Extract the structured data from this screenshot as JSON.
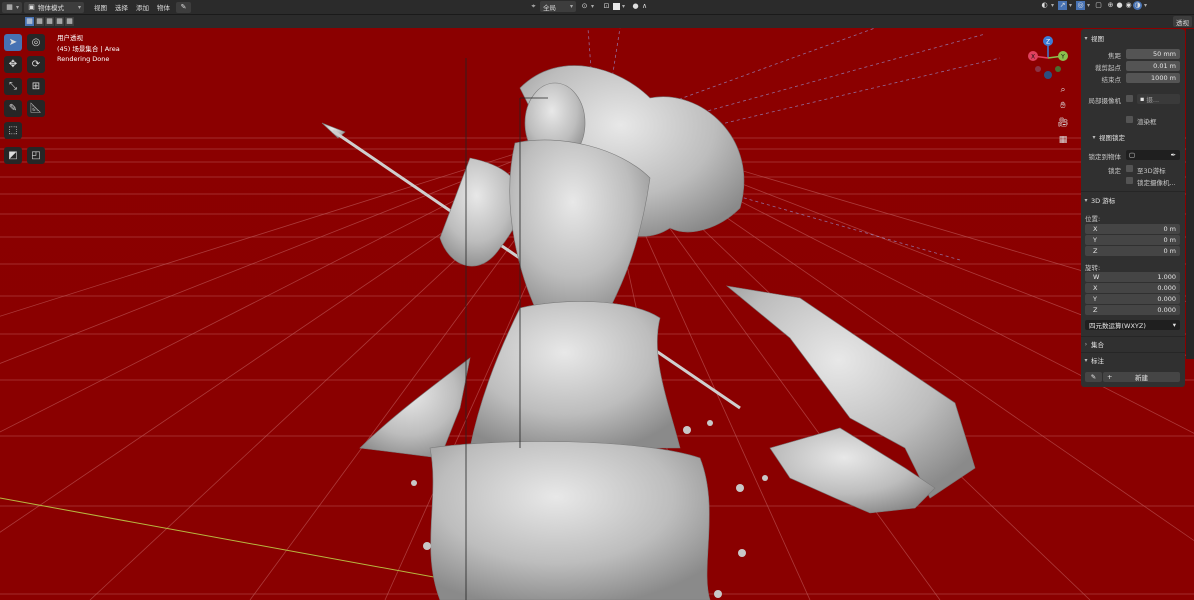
{
  "header": {
    "mode_label": "物体模式",
    "menus": [
      "视图",
      "选择",
      "添加",
      "物体"
    ],
    "transform_orientation": "全局",
    "overlay_right_label": "透视"
  },
  "viewport": {
    "view_name": "用户透视",
    "collection_info": "(45) 场景集合 | Area",
    "render_status": "Rendering Done",
    "background_color": "#8b0000"
  },
  "gizmo": {
    "z": "Z",
    "y": "Y",
    "x": "X"
  },
  "npanel": {
    "view": {
      "title": "视图",
      "focal_label": "焦距",
      "focal_value": "50 mm",
      "clip_start_label": "裁剪起点",
      "clip_start_value": "0.01 m",
      "clip_end_label": "结束点",
      "clip_end_value": "1000 m",
      "local_camera_label": "局部摄像机",
      "local_camera_value": "摄...",
      "render_region_label": "渲染框"
    },
    "view_lock": {
      "title": "视图锁定",
      "lock_to_object_label": "锁定到物体",
      "lock_label": "锁定",
      "lock_cursor_label": "至3D游标",
      "lock_camera_label": "锁定摄像机..."
    },
    "cursor": {
      "title": "3D 游标",
      "location_label": "位置:",
      "x_label": "X",
      "x_value": "0 m",
      "y_label": "Y",
      "y_value": "0 m",
      "z_label": "Z",
      "z_value": "0 m",
      "rotation_label": "旋转:",
      "rw_label": "W",
      "rw_value": "1.000",
      "rx_label": "X",
      "rx_value": "0.000",
      "ry_label": "Y",
      "ry_value": "0.000",
      "rz_label": "Z",
      "rz_value": "0.000",
      "rotation_mode": "四元数运算(WXYZ)"
    },
    "collection": {
      "title": "集合"
    },
    "annotation": {
      "title": "标注",
      "new_label": "新建"
    }
  }
}
